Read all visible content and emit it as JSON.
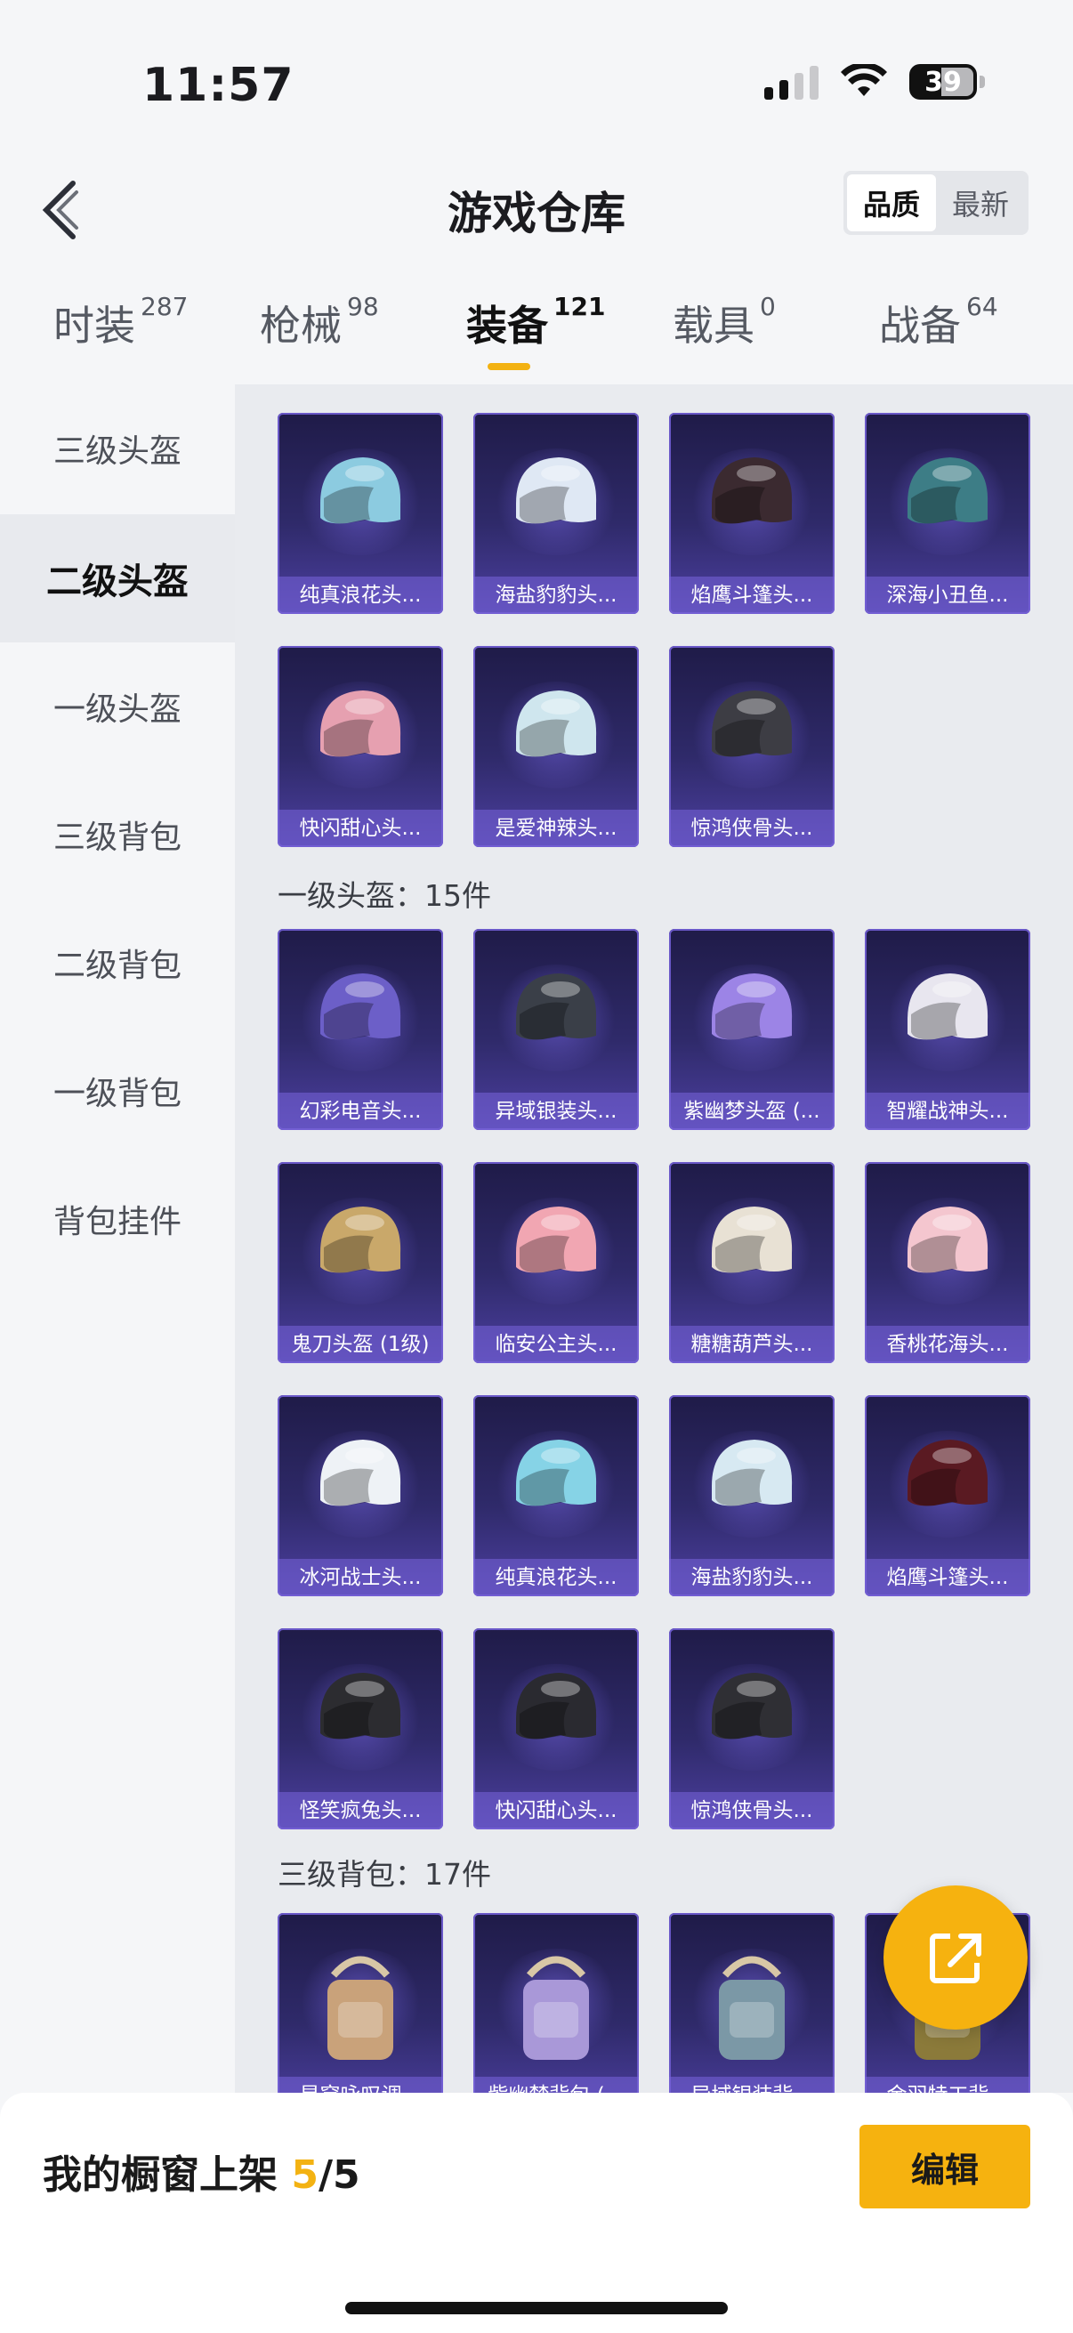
{
  "status": {
    "time": "11:57",
    "battery": "39"
  },
  "header": {
    "title": "游戏仓库",
    "sort": {
      "quality": "品质",
      "newest": "最新"
    }
  },
  "tabs": [
    {
      "label": "时装",
      "count": "287"
    },
    {
      "label": "枪械",
      "count": "98"
    },
    {
      "label": "装备",
      "count": "121"
    },
    {
      "label": "载具",
      "count": "0"
    },
    {
      "label": "战备",
      "count": "64"
    }
  ],
  "sidebar": [
    "三级头盔",
    "二级头盔",
    "一级头盔",
    "三级背包",
    "二级背包",
    "一级背包",
    "背包挂件"
  ],
  "sections": {
    "level1_helmet": "一级头盔：15件",
    "level3_backpack": "三级背包：17件"
  },
  "helmets_level2": [
    "纯真浪花头...",
    "海盐豹豹头...",
    "焰鹰斗篷头...",
    "深海小丑鱼...",
    "快闪甜心头...",
    "是爱神辣头...",
    "惊鸿侠骨头..."
  ],
  "helmets_level1": [
    "幻彩电音头...",
    "异域银装头...",
    "紫幽梦头盔 (...",
    "智耀战神头...",
    "鬼刀头盔 (1级)",
    "临安公主头...",
    "糖糖葫芦头...",
    "香桃花海头...",
    "冰河战士头...",
    "纯真浪花头...",
    "海盐豹豹头...",
    "焰鹰斗篷头...",
    "怪笑疯兔头...",
    "快闪甜心头...",
    "惊鸿侠骨头..."
  ],
  "backpacks_level3": [
    "星穹咏叹调...",
    "紫幽梦背包 (...",
    "异域银装背...",
    "金羽特工背..."
  ],
  "bottom": {
    "shelf_label": "我的橱窗上架",
    "shelf_count": "5",
    "shelf_total": "/5",
    "edit": "编辑"
  },
  "colors": {
    "accent": "#f6b20f",
    "card_bg": "#2f2a6a"
  },
  "helmet_colors": {
    "l2": [
      "#8ccbe0",
      "#dfe8f4",
      "#3b2a30",
      "#3d7d86",
      "#e6a0b0",
      "#cfe6ee",
      "#3d3d44"
    ],
    "l1": [
      "#6c5fc8",
      "#3a3f48",
      "#9c84e6",
      "#e8e6ef",
      "#c9a86a",
      "#f1a6b2",
      "#e8e1d4",
      "#f4c6cf",
      "#eef2f6",
      "#86d3e6",
      "#d7e9f2",
      "#5a1a22",
      "#2c2c30",
      "#2a2a30",
      "#2f2f34"
    ],
    "bp": [
      "#c9a27a",
      "#a998d8",
      "#7b98a6",
      "#8b7a3a"
    ]
  }
}
